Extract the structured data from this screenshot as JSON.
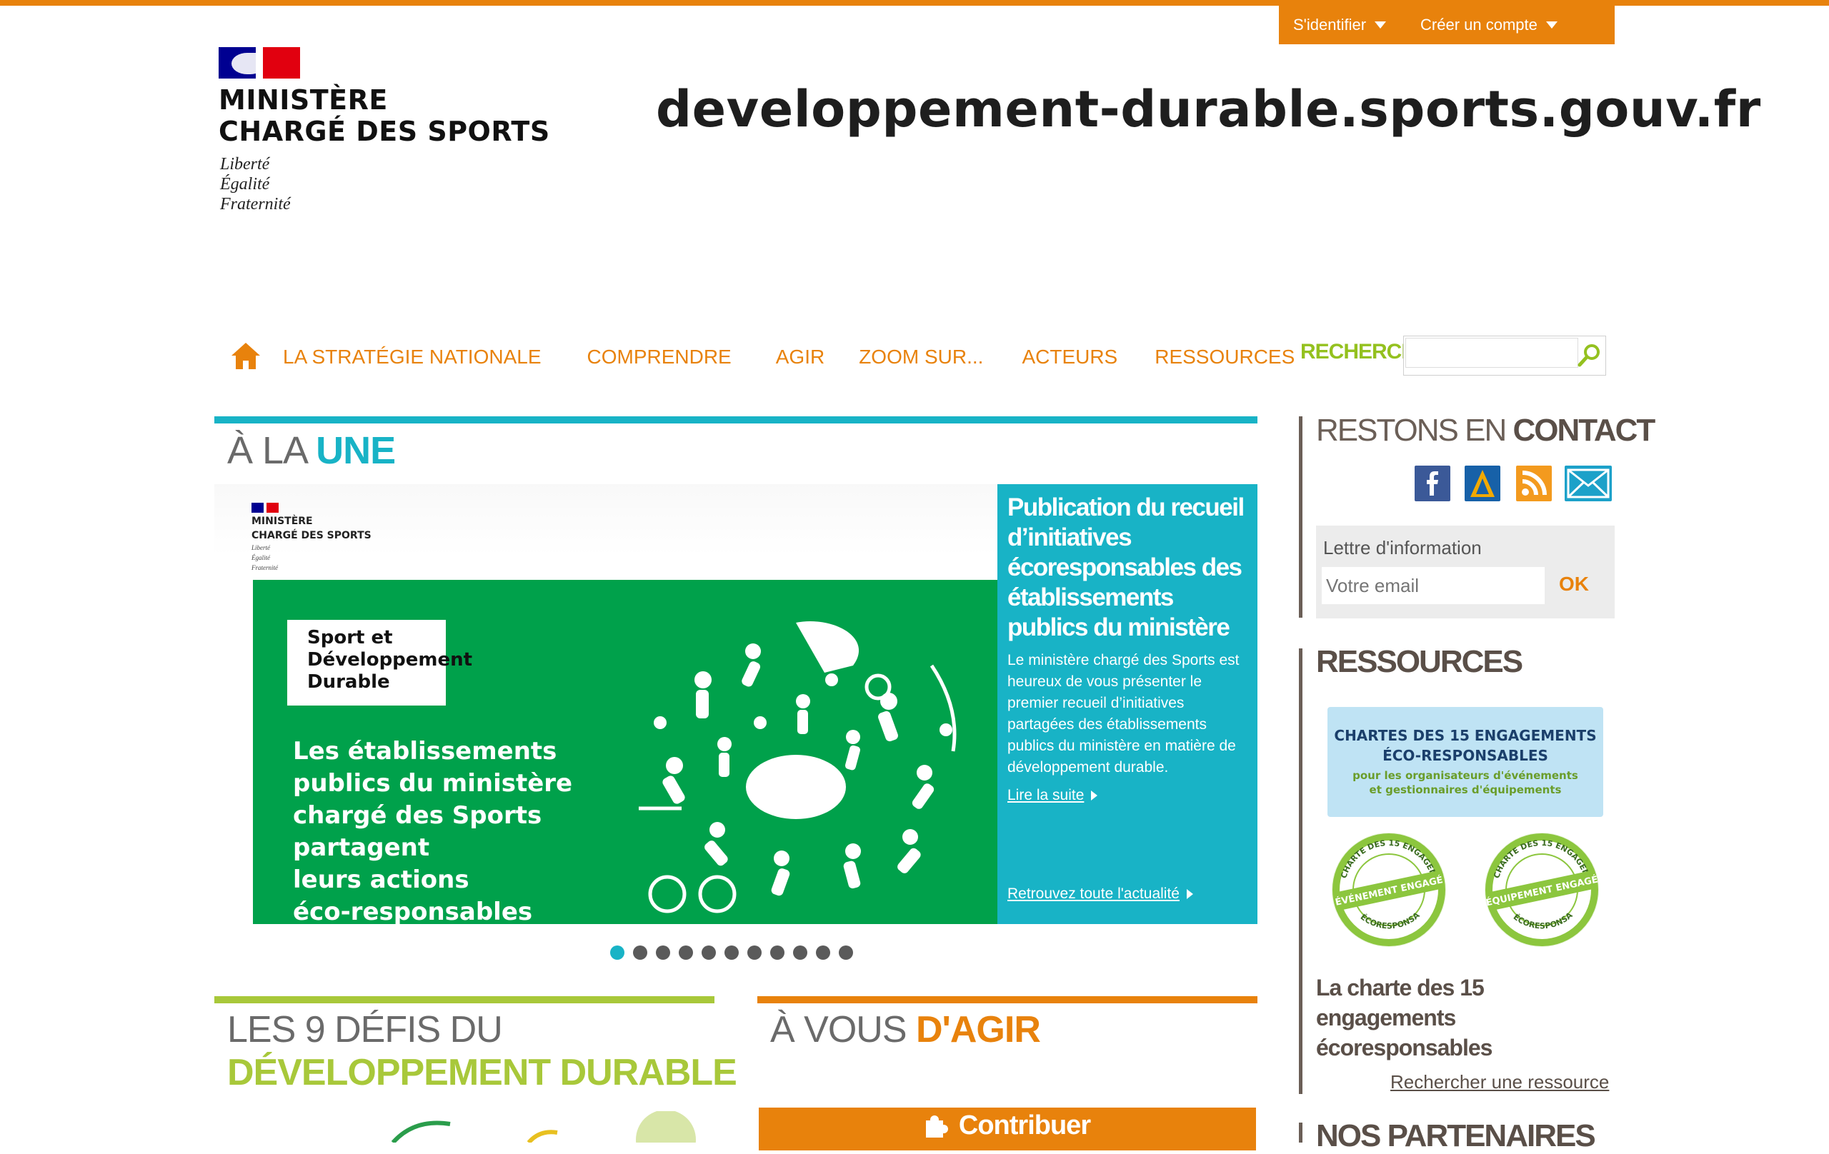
{
  "account": {
    "login": "S'identifier",
    "register": "Créer un compte"
  },
  "logo": {
    "line1": "MINISTÈRE",
    "line2": "CHARGÉ DES SPORTS",
    "motto": [
      "Liberté",
      "Égalité",
      "Fraternité"
    ]
  },
  "site_url": "developpement-durable.sports.gouv.fr",
  "nav": {
    "items": [
      "LA STRATÉGIE NATIONALE",
      "COMPRENDRE",
      "AGIR",
      "ZOOM SUR...",
      "ACTEURS",
      "RESSOURCES"
    ],
    "search_label": "RECHERCHE",
    "search_value": ""
  },
  "une": {
    "title_light": "À LA ",
    "title_bold": "UNE",
    "slide": {
      "image_logo": [
        "MINISTÈRE",
        "CHARGÉ DES SPORTS",
        "Liberté",
        "Égalité",
        "Fraternité"
      ],
      "box": [
        "Sport et",
        "Développement",
        "Durable"
      ],
      "headline": [
        "Les établissements",
        "publics du ministère",
        "chargé des Sports",
        "partagent",
        "leurs actions",
        "éco-responsables"
      ],
      "title": "Publication du recueil d’initiatives écoresponsables des établissements publics du ministère",
      "description": "Le ministère chargé des Sports est heureux de vous présenter le premier recueil d’initiatives partagées des établissements publics du ministère en matière de développement durable.",
      "read_more": "Lire la suite",
      "all_news": "Retrouvez toute l'actualité"
    },
    "dots_count": 11,
    "active_dot": 0
  },
  "defis": {
    "title_light": "LES 9 DÉFIS DU",
    "title_bold": "DÉVELOPPEMENT DURABLE"
  },
  "agir": {
    "title_light": "À VOUS ",
    "title_bold": "D'AGIR",
    "contribute": "Contribuer"
  },
  "sidebar": {
    "contact_light": "RESTONS EN ",
    "contact_bold": "CONTACT",
    "social": [
      "facebook-icon",
      "dailymotion-icon",
      "rss-icon",
      "email-icon"
    ],
    "newsletter_label": "Lettre d'information",
    "newsletter_placeholder": "Votre email",
    "newsletter_ok": "OK",
    "resources_title": "RESSOURCES",
    "charte_banner": [
      "CHARTES DES 15 ENGAGEMENTS",
      "ÉCO-RESPONSABLES",
      "pour les organisateurs d'événements",
      "et gestionnaires d'équipements"
    ],
    "badge_event": "ÉVÉNEMENT ENGAGÉ",
    "badge_equip": "ÉQUIPEMENT ENGAGÉ",
    "badge_ring_event": "CHARTE DES 15 ENGAGEMENTS",
    "badge_ring_equip": "CHARTE DES 15 ENGAGEMENTS",
    "badge_low": "ÉCORESPONSABLES",
    "resource_caption": "La charte des 15 engagements écoresponsables",
    "resource_link": "Rechercher une ressource",
    "partners_title": "NOS PARTENAIRES"
  },
  "colors": {
    "orange": "#e8820c",
    "teal": "#18b3c6",
    "green": "#94c11f",
    "brown": "#5a4f48"
  }
}
